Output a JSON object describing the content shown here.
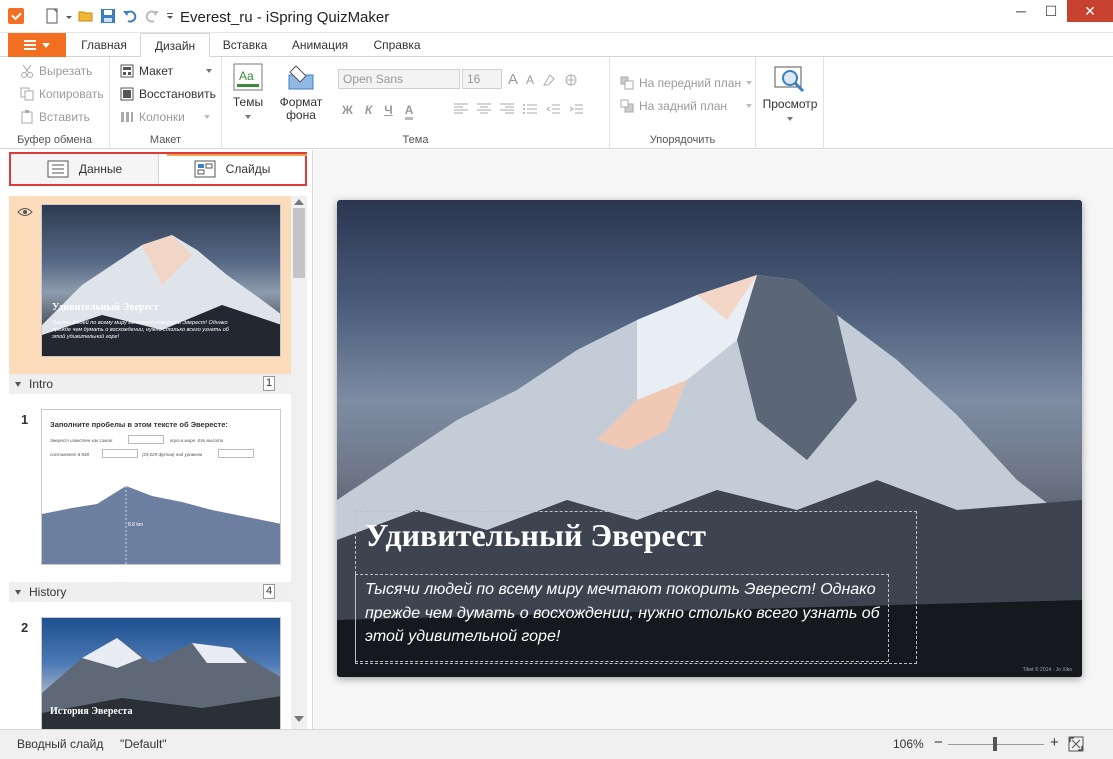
{
  "window": {
    "title": "Everest_ru - iSpring QuizMaker",
    "minimize": "─",
    "maximize": "☐",
    "close": "✕"
  },
  "ribbon_tabs": [
    "Главная",
    "Дизайн",
    "Вставка",
    "Анимация",
    "Справка"
  ],
  "active_tab": "Дизайн",
  "clipboard": {
    "cut": "Вырезать",
    "copy": "Копировать",
    "paste": "Вставить",
    "label": "Буфер обмена"
  },
  "layout": {
    "layout_btn": "Макет",
    "reset": "Восстановить",
    "columns": "Колонки",
    "label": "Макет"
  },
  "theme": {
    "themes": "Темы",
    "format_bg_line1": "Формат",
    "format_bg_line2": "фона",
    "font_name": "Open Sans",
    "font_size": "16",
    "bold": "Ж",
    "italic": "К",
    "underline": "Ч",
    "font_color": "А",
    "label": "Тема"
  },
  "arrange": {
    "bring_front": "На передний план",
    "send_back": "На задний план",
    "label": "Упорядочить"
  },
  "preview": {
    "label": "Просмотр"
  },
  "view_tabs": {
    "data": "Данные",
    "slides": "Слайды"
  },
  "slides_panel": {
    "intro_thumb": {
      "title": "Удивительный Эверест",
      "text": "Тысячи людей по всему миру мечтают покорить Эверест! Однако прежде чем думать о восхождении, нужно столько всего узнать об этой удивительной горе!"
    },
    "sections": [
      {
        "name": "Intro",
        "count": "1"
      },
      {
        "name": "History",
        "count": "4"
      }
    ],
    "slide1": {
      "number": "1",
      "title": "Заполните пробелы в этом тексте об Эвересте:",
      "line1a": "Эверест известен как самая",
      "line1b": "гора в мире. Его высота",
      "line2a": "составляет 8 848",
      "line2b": "(29,029 футов) над уровнем",
      "height_label": "8.8 km"
    },
    "slide2": {
      "number": "2",
      "title": "История Эвереста"
    }
  },
  "slide": {
    "title": "Удивительный Эверест",
    "subtitle": "Тысячи людей по всему миру мечтают покорить Эверест! Однако прежде чем думать о восхождении, нужно столько всего узнать об этой удивительной горе!",
    "credit": "Tibet © 2014 · Jo Xiko"
  },
  "statusbar": {
    "slide_name": "Вводный слайд",
    "theme_name": "\"Default\"",
    "zoom": "106%",
    "zoom_minus": "−",
    "zoom_plus": "+"
  },
  "colors": {
    "accent": "#f26f21",
    "close_red": "#c7412f",
    "highlight_border": "#e0393a",
    "selected_bg": "#fddcbc"
  }
}
